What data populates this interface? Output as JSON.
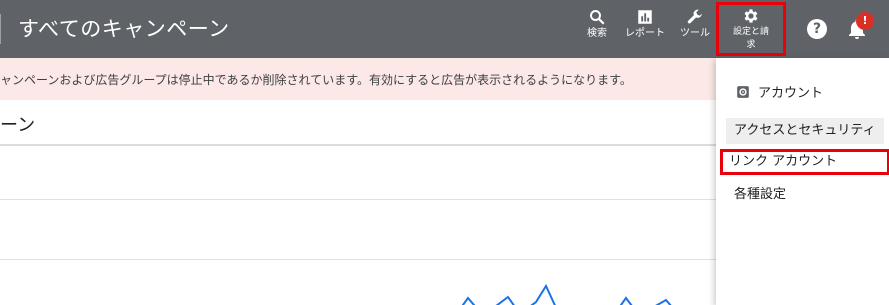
{
  "header": {
    "title": "すべてのキャンペーン",
    "tools": {
      "search": "検索",
      "reports": "レポート",
      "tools": "ツール",
      "settings_line1": "設定と請",
      "settings_line2": "求"
    },
    "help_symbol": "?",
    "notification_badge": "!"
  },
  "alert": {
    "text": "ャンペーンおよび広告グループは停止中であるか削除されています。有効にすると広告が表示されるようになります。"
  },
  "section": {
    "title": "ーン"
  },
  "settings_menu": {
    "header": "アカウント",
    "items": [
      "アクセスとセキュリティ",
      "リンク アカウント",
      "各種設定"
    ]
  },
  "colors": {
    "topbar": "#5f6368",
    "highlight_box": "#e8000b",
    "alert_bg": "#fce8e6",
    "chart_line": "#1a73e8",
    "badge": "#d93025"
  },
  "icons": [
    "search-icon",
    "reports-icon",
    "wrench-icon",
    "gear-icon",
    "help-icon",
    "bell-icon"
  ]
}
